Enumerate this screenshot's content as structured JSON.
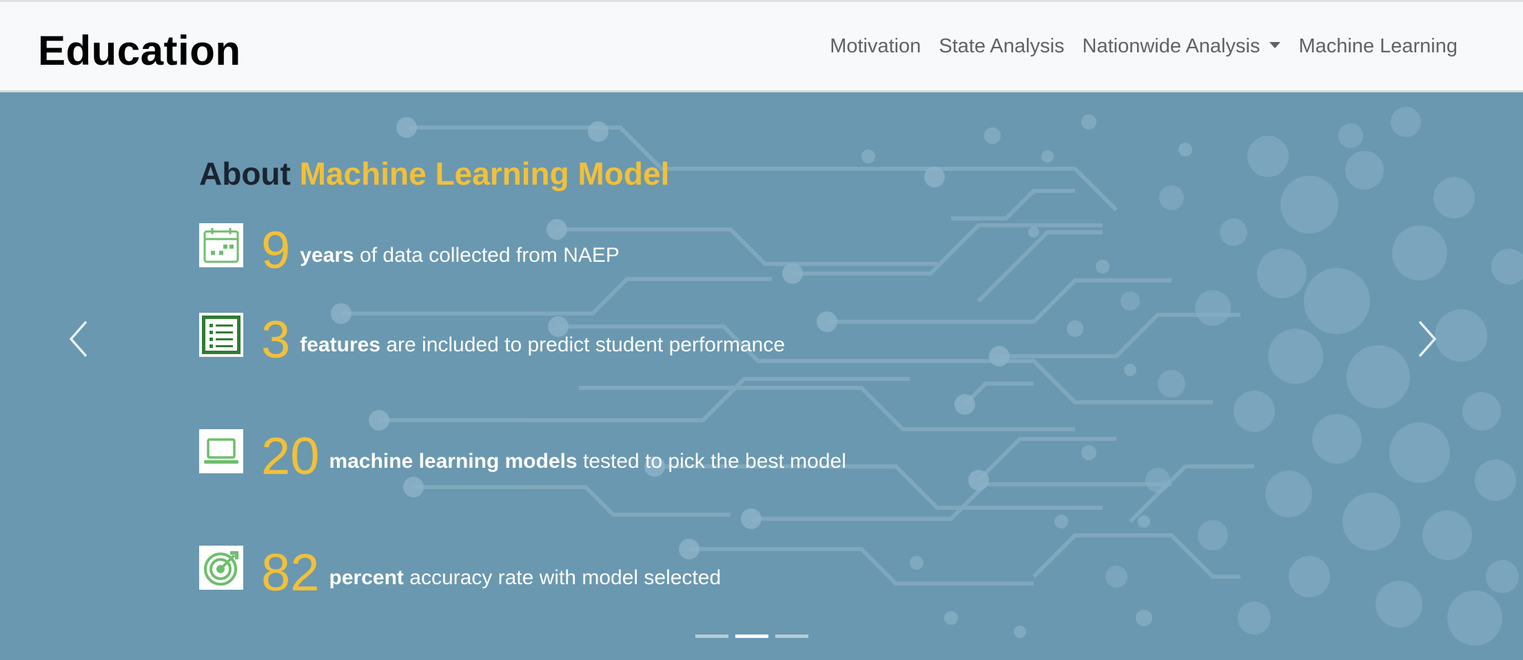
{
  "navbar": {
    "brand": "Education",
    "links": [
      "Motivation",
      "State Analysis",
      "Nationwide Analysis",
      "Machine Learning"
    ]
  },
  "carousel": {
    "heading_prefix": "About",
    "heading_accent": "Machine Learning Model",
    "items": [
      {
        "number": "9",
        "bold": "years",
        "rest": " of data collected from NAEP",
        "icon": "calendar-icon"
      },
      {
        "number": "3",
        "bold": "features",
        "rest": " are included to predict student performance",
        "icon": "list-icon"
      },
      {
        "number": "20",
        "bold": "machine learning models",
        "rest": " tested to pick the best model",
        "icon": "laptop-icon"
      },
      {
        "number": "82",
        "bold": "percent",
        "rest": " accuracy rate with model selected",
        "icon": "target-icon"
      }
    ],
    "active_slide": 1,
    "slide_count": 3
  },
  "colors": {
    "accent": "#f2c039",
    "background": "#6a98b0",
    "navbar_bg": "#f8f9fa",
    "icon_green": "#5cb85c"
  }
}
